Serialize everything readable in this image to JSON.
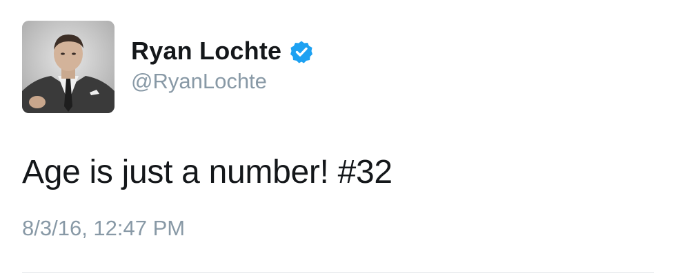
{
  "tweet": {
    "author": {
      "display_name": "Ryan Lochte",
      "handle": "@RyanLochte",
      "verified": true,
      "avatar_icon": "profile-photo",
      "verified_icon": "verified-badge-icon"
    },
    "text": "Age is just a number! #32",
    "timestamp": "8/3/16, 12:47 PM"
  },
  "colors": {
    "name": "#14171a",
    "secondary_text": "#8899a6",
    "verified_badge": "#1da1f2",
    "divider": "#dfe3e6"
  }
}
